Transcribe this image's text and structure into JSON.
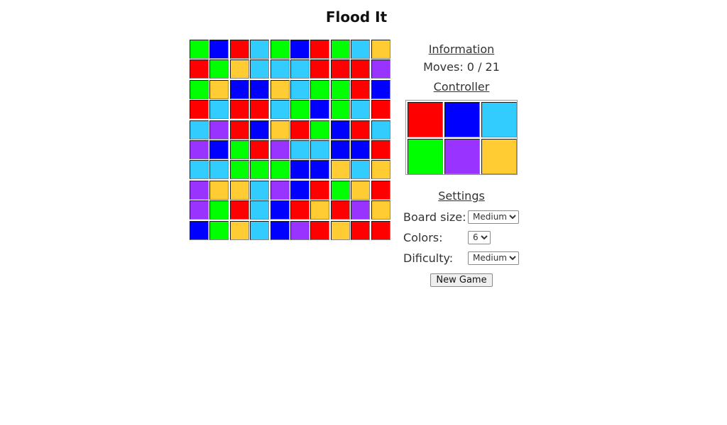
{
  "title": "Flood It",
  "palette": {
    "R": "#ff0000",
    "B": "#0000ff",
    "C": "#33ccff",
    "G": "#00ff00",
    "P": "#9933ff",
    "Y": "#ffcc33"
  },
  "board": {
    "size": 10,
    "rows": [
      [
        "G",
        "B",
        "R",
        "C",
        "G",
        "B",
        "R",
        "G",
        "C",
        "Y"
      ],
      [
        "R",
        "G",
        "Y",
        "C",
        "C",
        "C",
        "R",
        "R",
        "R",
        "P"
      ],
      [
        "G",
        "Y",
        "B",
        "B",
        "Y",
        "C",
        "G",
        "G",
        "R",
        "B"
      ],
      [
        "R",
        "C",
        "R",
        "R",
        "C",
        "G",
        "B",
        "G",
        "C",
        "R"
      ],
      [
        "C",
        "P",
        "R",
        "B",
        "Y",
        "R",
        "G",
        "B",
        "R",
        "C"
      ],
      [
        "P",
        "B",
        "G",
        "R",
        "P",
        "C",
        "C",
        "B",
        "B",
        "R"
      ],
      [
        "C",
        "C",
        "G",
        "G",
        "G",
        "B",
        "B",
        "Y",
        "C",
        "Y"
      ],
      [
        "P",
        "Y",
        "Y",
        "C",
        "P",
        "B",
        "R",
        "G",
        "Y",
        "R"
      ],
      [
        "P",
        "G",
        "R",
        "C",
        "B",
        "R",
        "Y",
        "R",
        "P",
        "Y"
      ],
      [
        "B",
        "G",
        "Y",
        "C",
        "B",
        "P",
        "R",
        "Y",
        "R",
        "R"
      ]
    ]
  },
  "information": {
    "heading": "Information",
    "moves_label": "Moves: 0 / 21",
    "moves_current": 0,
    "moves_max": 21
  },
  "controller": {
    "heading": "Controller",
    "buttons": [
      {
        "name": "red",
        "color": "R"
      },
      {
        "name": "blue",
        "color": "B"
      },
      {
        "name": "cyan",
        "color": "C"
      },
      {
        "name": "green",
        "color": "G"
      },
      {
        "name": "purple",
        "color": "P"
      },
      {
        "name": "yellow",
        "color": "Y"
      }
    ]
  },
  "settings": {
    "heading": "Settings",
    "board_size": {
      "label": "Board size:",
      "value": "Medium"
    },
    "colors": {
      "label": "Colors:",
      "value": "6"
    },
    "difficulty": {
      "label": "Dificulty:",
      "value": "Medium"
    },
    "new_game_label": "New Game"
  }
}
